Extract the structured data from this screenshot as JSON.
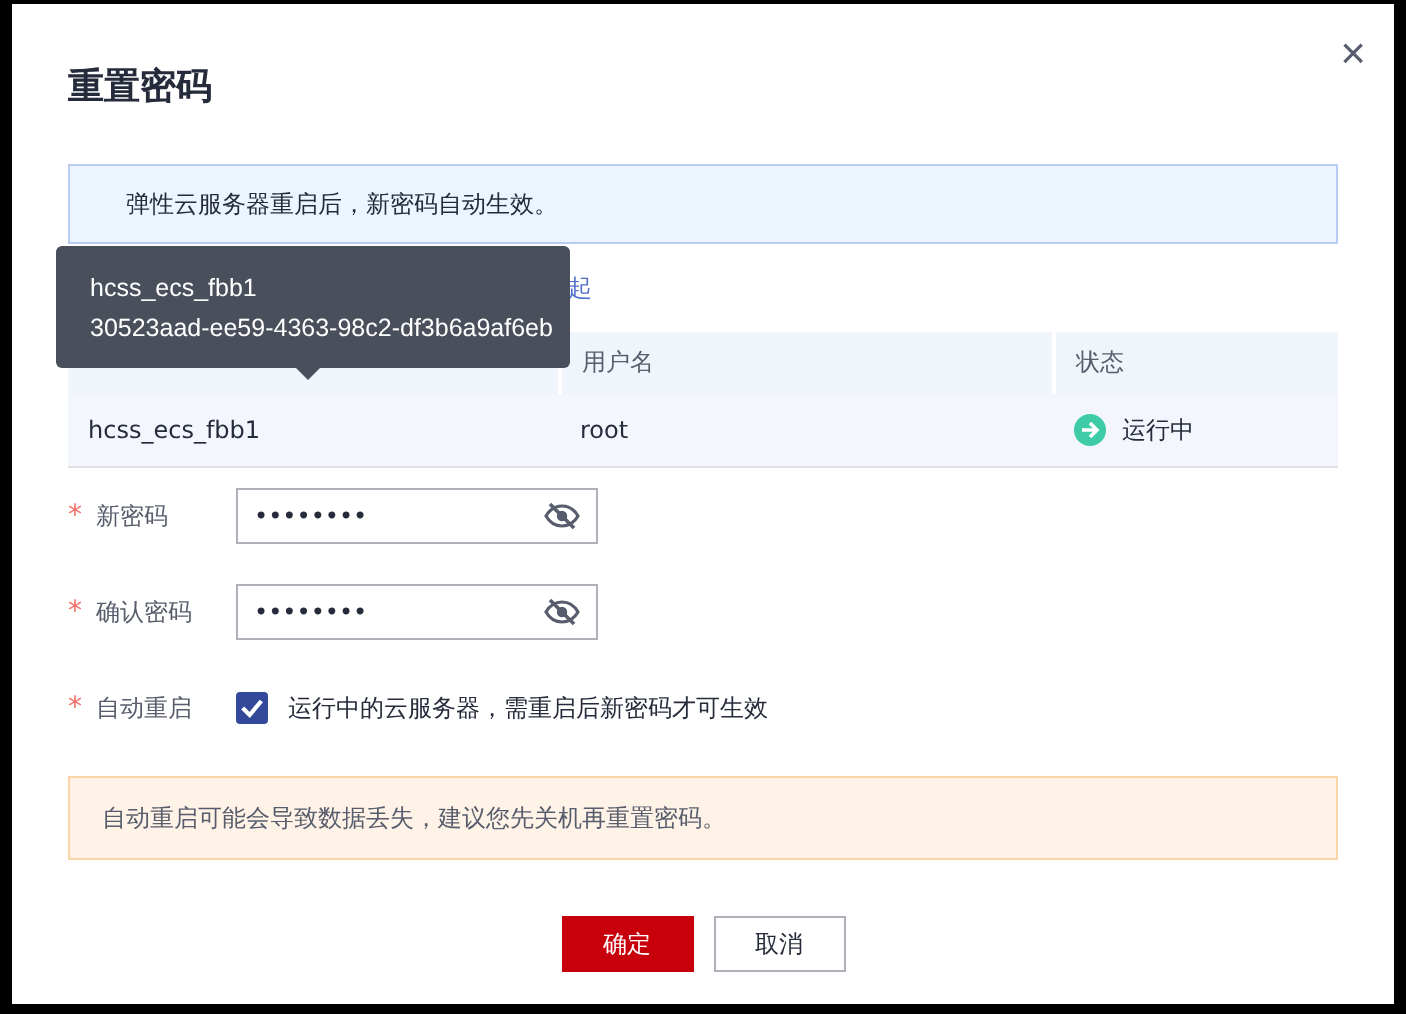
{
  "dialog": {
    "title": "重置密码",
    "close": "×"
  },
  "info": "弹性云服务器重启后，新密码自动生效。",
  "link": "起",
  "tooltip": {
    "lines": [
      "hcss_ecs_fbb1",
      "30523aad-ee59-4363-98c2-df3b6a9af6eb"
    ]
  },
  "table": {
    "columns": [
      "",
      "用户名",
      "状态"
    ],
    "rows": [
      {
        "cells": [
          "hcss_ecs_fbb1",
          "root"
        ],
        "status": {
          "kind": "running",
          "label": "运行中"
        }
      }
    ]
  },
  "fields": [
    {
      "kind": "password",
      "mark": "*",
      "label": "新密码",
      "value": "••••••••"
    },
    {
      "kind": "password",
      "mark": "*",
      "label": "确认密码",
      "value": "••••••••"
    },
    {
      "kind": "checkbox",
      "mark": "*",
      "label": "自动重启",
      "checked": true,
      "text": "运行中的云服务器，需重启后新密码才可生效"
    }
  ],
  "warning": "自动重启可能会导致数据丢失，建议您先关机再重置密码。",
  "buttons": [
    {
      "kind": "primary",
      "label": "确定"
    },
    {
      "kind": "default",
      "label": "取消"
    }
  ]
}
